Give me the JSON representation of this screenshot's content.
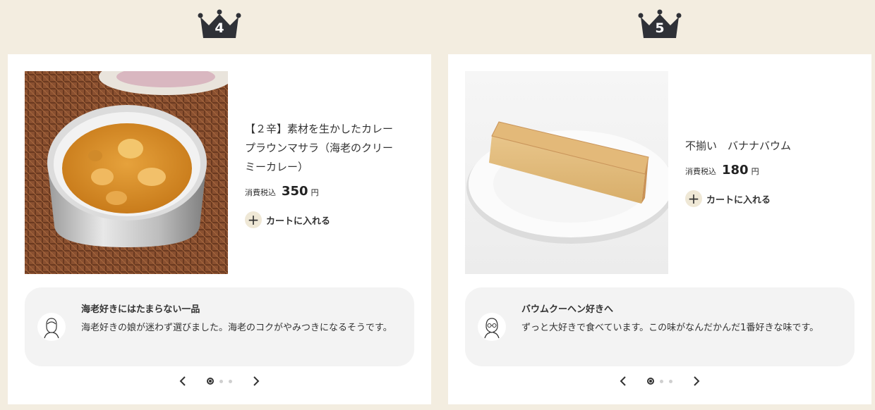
{
  "items": [
    {
      "rank": "4",
      "name": "【２辛】素材を生かしたカレー　プラウンマサラ（海老のクリーミーカレー）",
      "tax_label": "消費税込",
      "price": "350",
      "yen": "円",
      "cart_label": "カートに入れる",
      "image": "curry-bowl-image",
      "comment": {
        "title": "海老好きにはたまらない一品",
        "body": "海老好きの娘が迷わず選びました。海老のコクがやみつきになるそうです。"
      },
      "pager": {
        "pages": 3,
        "current": 1
      }
    },
    {
      "rank": "5",
      "name": "不揃い　バナナバウム",
      "tax_label": "消費税込",
      "price": "180",
      "yen": "円",
      "cart_label": "カートに入れる",
      "image": "banana-baumkuchen-image",
      "comment": {
        "title": "バウムクーヘン好きへ",
        "body": "ずっと大好きで食べています。この味がなんだかんだ1番好きな味です。"
      },
      "pager": {
        "pages": 3,
        "current": 1
      }
    }
  ],
  "colors": {
    "background": "#f3ede0",
    "crown": "#2f3137",
    "plus_bg": "#efe8d6",
    "comment_bg": "#f3f3f3"
  },
  "icons": {
    "crown": "crown-icon",
    "plus": "plus-icon",
    "prev": "chevron-left-icon",
    "next": "chevron-right-icon"
  }
}
